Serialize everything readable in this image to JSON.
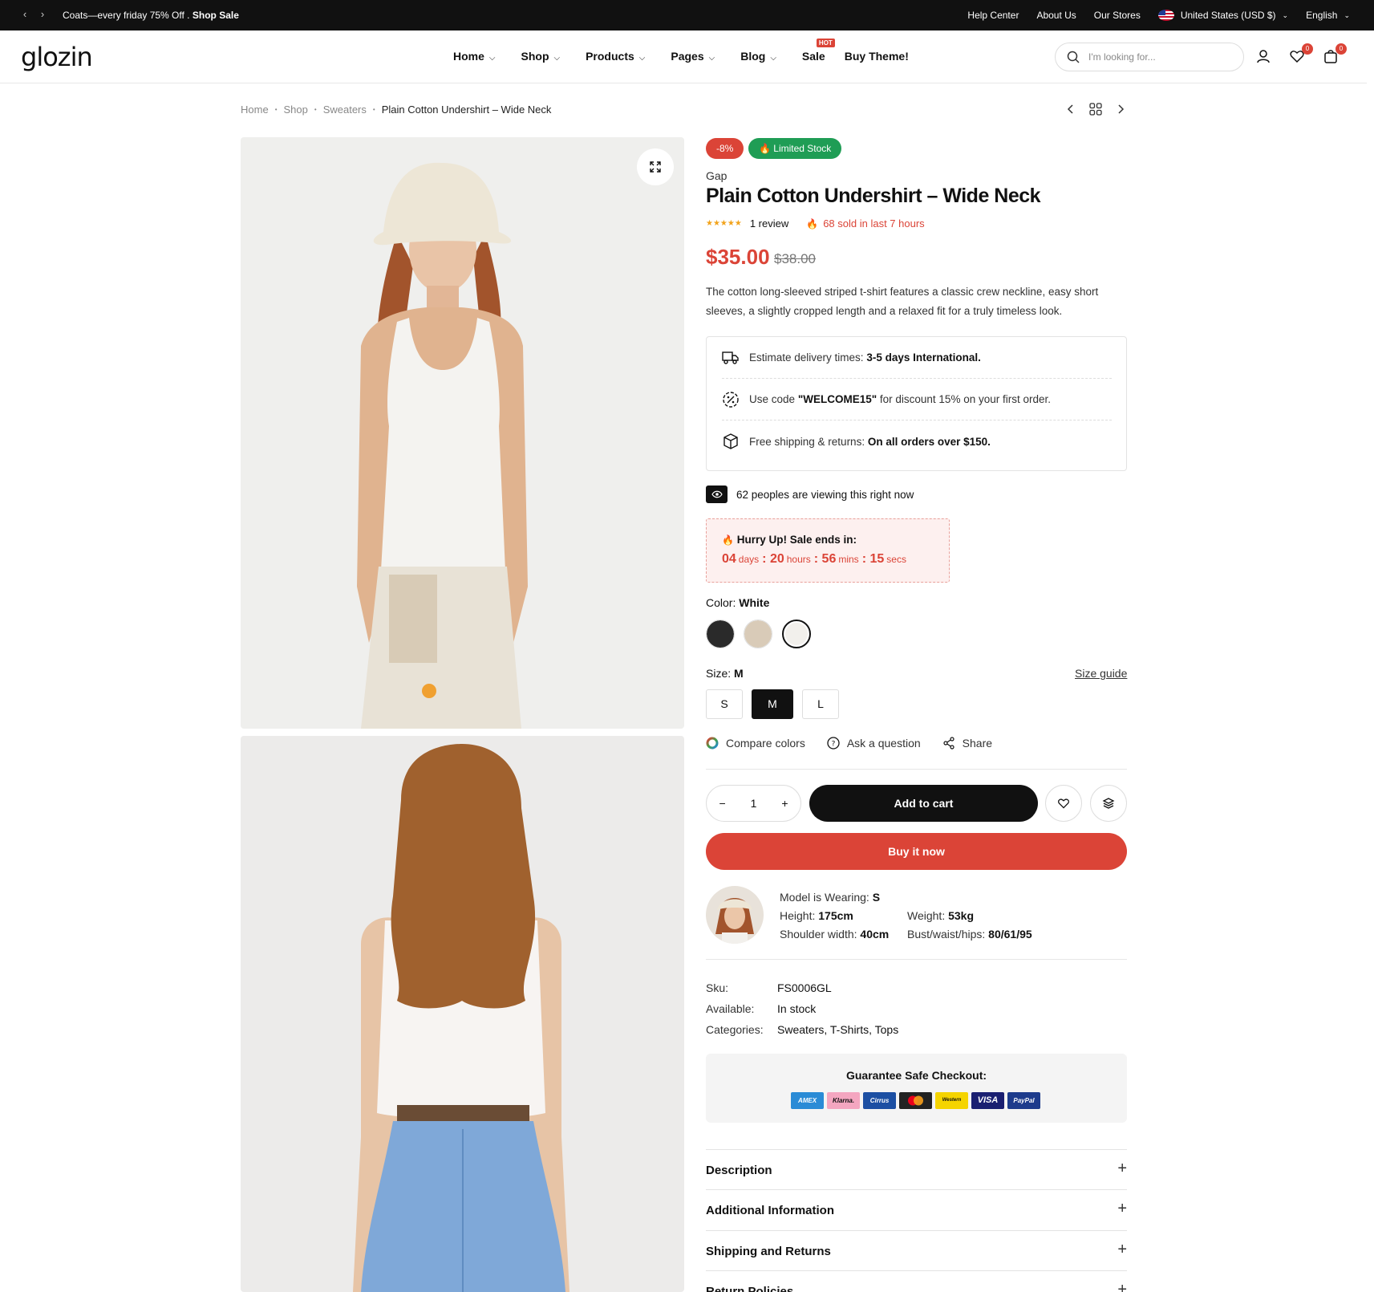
{
  "topbar": {
    "promo_text": "Coats—every friday 75% Off .",
    "promo_link": "Shop Sale",
    "links": [
      "Help Center",
      "About Us",
      "Our Stores"
    ],
    "currency": "United States (USD $)",
    "language": "English"
  },
  "header": {
    "logo": "glozin",
    "nav": [
      {
        "label": "Home",
        "has_dropdown": true
      },
      {
        "label": "Shop",
        "has_dropdown": true
      },
      {
        "label": "Products",
        "has_dropdown": true
      },
      {
        "label": "Pages",
        "has_dropdown": true
      },
      {
        "label": "Blog",
        "has_dropdown": true
      },
      {
        "label": "Sale",
        "has_dropdown": false
      },
      {
        "label": "Buy Theme!",
        "has_dropdown": false
      }
    ],
    "sale_badge": "HOT",
    "search_placeholder": "I'm looking for...",
    "wishlist_count": "0",
    "cart_count": "0"
  },
  "breadcrumb": [
    "Home",
    "Shop",
    "Sweaters",
    "Plain Cotton Undershirt – Wide Neck"
  ],
  "product": {
    "discount_badge": "-8%",
    "stock_badge": "Limited Stock",
    "brand": "Gap",
    "title": "Plain Cotton Undershirt – Wide Neck",
    "stars": "★★★★★",
    "reviews": "1 review",
    "sold": "68 sold in last 7 hours",
    "price": "$35.00",
    "old_price": "$38.00",
    "description": "The cotton long-sleeved striped t-shirt features a classic crew neckline, easy short sleeves, a slightly cropped length and a relaxed fit for a truly timeless look."
  },
  "info": {
    "delivery_label": "Estimate delivery times:",
    "delivery_value": "3-5 days International.",
    "code_pre": "Use code",
    "code_value": "\"WELCOME15\"",
    "code_post": "for discount 15% on your first order.",
    "shipping_label": "Free shipping & returns:",
    "shipping_value": "On all orders over $150."
  },
  "viewing": "62 peoples are viewing this right now",
  "countdown": {
    "heading": "Hurry Up! Sale ends in:",
    "days": "04",
    "days_label": "days",
    "hours": "20",
    "hours_label": "hours",
    "mins": "56",
    "mins_label": "mins",
    "secs": "15",
    "secs_label": "secs"
  },
  "color": {
    "label": "Color:",
    "value": "White",
    "swatches": [
      "black",
      "beige",
      "white"
    ],
    "colors": [
      "#2a2a2a",
      "#d9cbb8",
      "#f2f0ec"
    ]
  },
  "size": {
    "label": "Size:",
    "value": "M",
    "guide": "Size guide",
    "options": [
      "S",
      "M",
      "L"
    ]
  },
  "actions": [
    "Compare colors",
    "Ask a question",
    "Share"
  ],
  "cart": {
    "qty": "1",
    "add_label": "Add to cart",
    "buy_label": "Buy it now"
  },
  "model": {
    "wearing_label": "Model is Wearing:",
    "wearing": "S",
    "height_label": "Height:",
    "height": "175cm",
    "weight_label": "Weight:",
    "weight": "53kg",
    "shoulder_label": "Shoulder width:",
    "shoulder": "40cm",
    "bust_label": "Bust/waist/hips:",
    "bust": "80/61/95"
  },
  "meta": {
    "sku_label": "Sku:",
    "sku": "FS0006GL",
    "available_label": "Available:",
    "available": "In stock",
    "categories_label": "Categories:",
    "categories": "Sweaters, T-Shirts, Tops"
  },
  "checkout": {
    "title": "Guarantee Safe Checkout:",
    "payments": [
      "AMEX",
      "Klarna.",
      "Cirrus",
      "Master",
      "Western",
      "VISA",
      "PayPal"
    ],
    "colors": [
      "#2a8bd6",
      "#f4a6c0",
      "#1c4fa3",
      "#222",
      "#f5d400",
      "#1a1f71",
      "#1d3b8c"
    ]
  },
  "accordion": [
    "Description",
    "Additional Information",
    "Shipping and Returns",
    "Return Policies"
  ],
  "accent": "#db4437"
}
